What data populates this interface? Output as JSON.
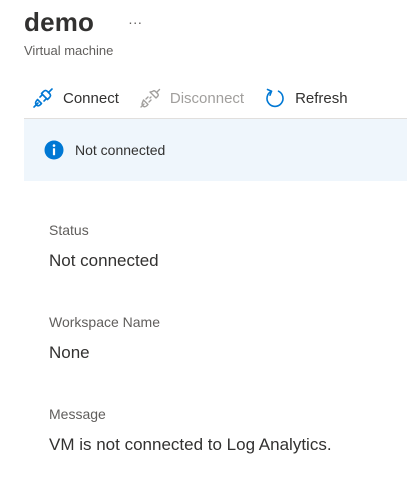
{
  "header": {
    "title": "demo",
    "more_label": "···",
    "subtitle": "Virtual machine"
  },
  "toolbar": {
    "connect_label": "Connect",
    "disconnect_label": "Disconnect",
    "refresh_label": "Refresh"
  },
  "banner": {
    "text": "Not connected",
    "icon": "info-icon",
    "color": "#0078d4"
  },
  "fields": {
    "status": {
      "label": "Status",
      "value": "Not connected"
    },
    "workspace": {
      "label": "Workspace Name",
      "value": "None"
    },
    "message": {
      "label": "Message",
      "value": "VM is not connected to Log Analytics."
    }
  },
  "colors": {
    "accent": "#0078d4",
    "banner_bg": "#eff6fc",
    "disabled": "#a19f9d"
  }
}
